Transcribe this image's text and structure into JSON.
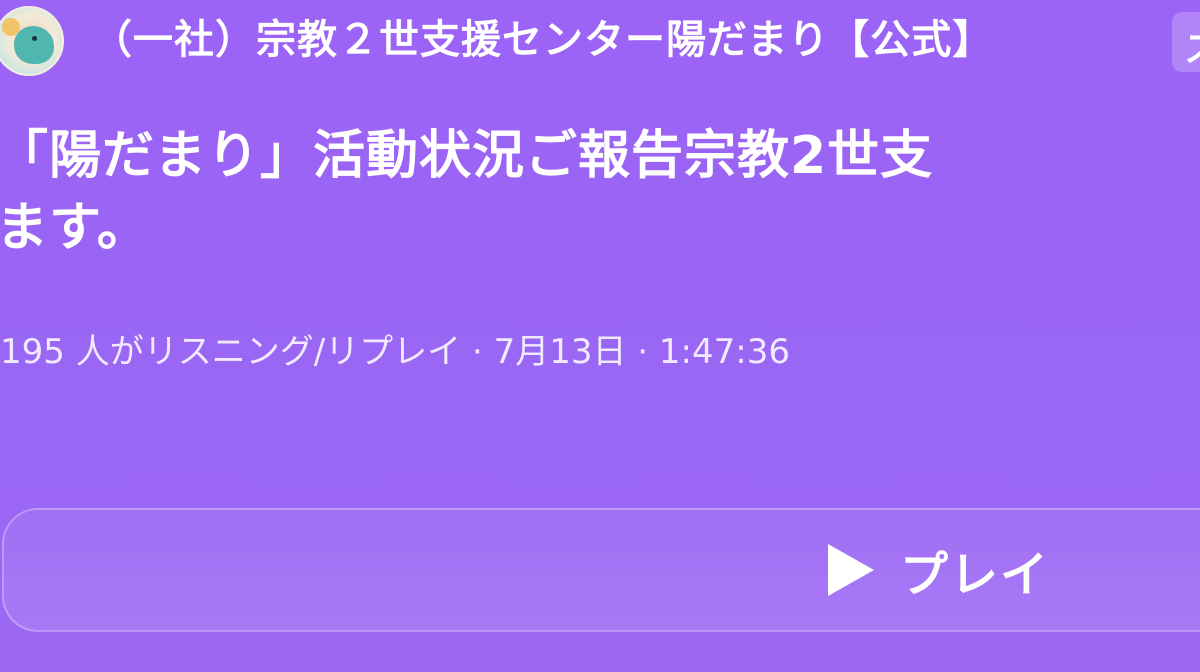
{
  "header": {
    "channel_name": "（一社）宗教２世支援センター陽だまり【公式】",
    "chip_text": "ス"
  },
  "episode": {
    "title_line1": "「陽だまり」活動状況ご報告宗教2世支",
    "title_line2": "ます。",
    "meta": "195 人がリスニング/リプレイ · 7月13日 · 1:47:36"
  },
  "player": {
    "play_label": "プレイ"
  },
  "colors": {
    "background": "#9a64f5",
    "text": "#ffffff"
  }
}
